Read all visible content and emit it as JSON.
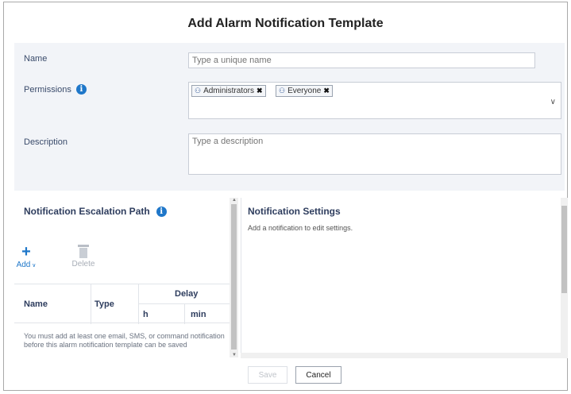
{
  "dialog": {
    "title": "Add Alarm Notification Template"
  },
  "form": {
    "name_label": "Name",
    "name_placeholder": "Type a unique name",
    "permissions_label": "Permissions",
    "permissions_chips": [
      {
        "label": "Administrators"
      },
      {
        "label": "Everyone"
      }
    ],
    "chip_group_icon": "group-icon",
    "chip_remove_glyph": "✖",
    "description_label": "Description",
    "description_placeholder": "Type a description"
  },
  "escalation": {
    "title": "Notification Escalation Path",
    "add_label": "Add",
    "delete_label": "Delete",
    "columns": {
      "name": "Name",
      "type": "Type",
      "delay": "Delay",
      "hours": "h",
      "minutes": "min"
    },
    "warning": "You must add at least one email, SMS, or command notification before this alarm notification template can be saved"
  },
  "settings": {
    "title": "Notification Settings",
    "hint": "Add a notification to edit settings."
  },
  "footer": {
    "save_label": "Save",
    "cancel_label": "Cancel"
  },
  "colors": {
    "accent": "#1f77c9",
    "form_background": "#f2f4f8"
  }
}
